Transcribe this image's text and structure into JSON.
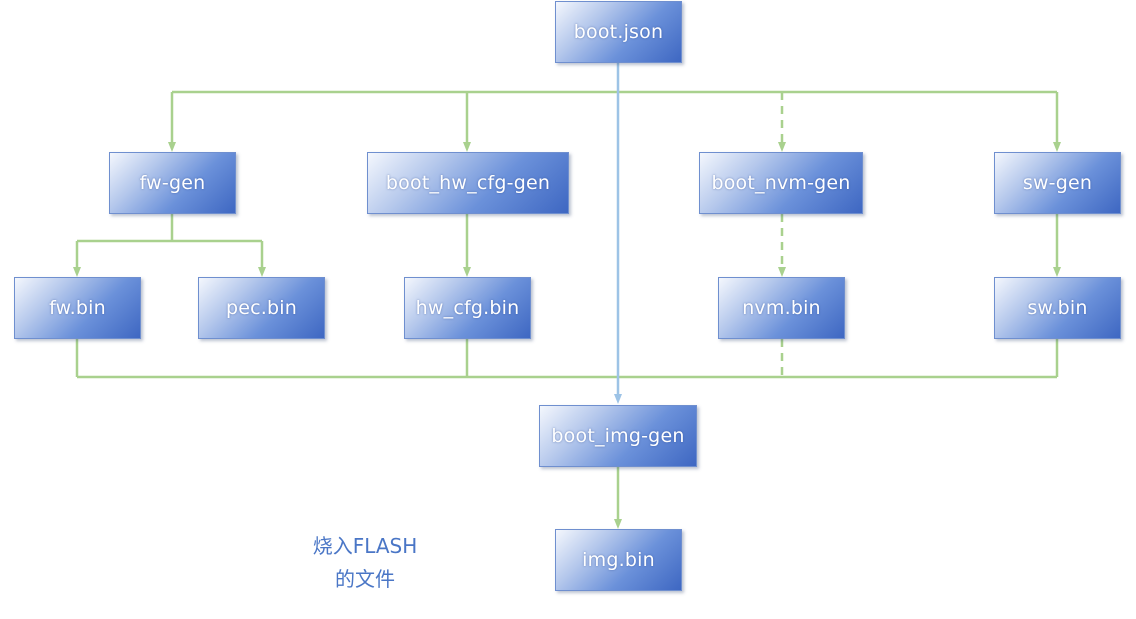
{
  "colors": {
    "green_line": "#a9d18e",
    "blue_line": "#9dc3e6",
    "note_text": "#4a76c6"
  },
  "nodes": {
    "boot_json": "boot.json",
    "fw_gen": "fw-gen",
    "boot_hw_cfg_gen": "boot_hw_cfg-gen",
    "boot_nvm_gen": "boot_nvm-gen",
    "sw_gen": "sw-gen",
    "fw_bin": "fw.bin",
    "pec_bin": "pec.bin",
    "hw_cfg_bin": "hw_cfg.bin",
    "nvm_bin": "nvm.bin",
    "sw_bin": "sw.bin",
    "boot_img_gen": "boot_img-gen",
    "img_bin": "img.bin"
  },
  "note": {
    "line1": "烧入FLASH",
    "line2": "的文件"
  }
}
